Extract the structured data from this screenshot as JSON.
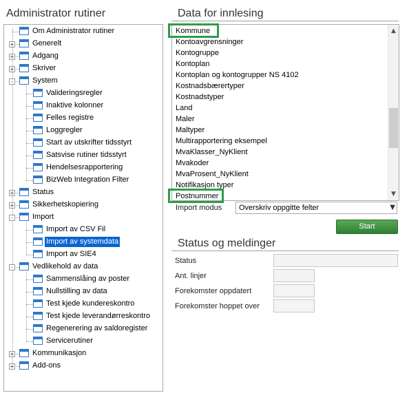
{
  "left_panel": {
    "title": "Administrator rutiner"
  },
  "tree": [
    {
      "label": "Om Administrator rutiner",
      "level": 0,
      "expander": "",
      "selected": false
    },
    {
      "label": "Generelt",
      "level": 0,
      "expander": "+",
      "selected": false
    },
    {
      "label": "Adgang",
      "level": 0,
      "expander": "+",
      "selected": false
    },
    {
      "label": "Skriver",
      "level": 0,
      "expander": "+",
      "selected": false
    },
    {
      "label": "System",
      "level": 0,
      "expander": "-",
      "selected": false
    },
    {
      "label": "Valideringsregler",
      "level": 1,
      "expander": "",
      "selected": false
    },
    {
      "label": "Inaktive kolonner",
      "level": 1,
      "expander": "",
      "selected": false
    },
    {
      "label": "Felles registre",
      "level": 1,
      "expander": "",
      "selected": false
    },
    {
      "label": "Loggregler",
      "level": 1,
      "expander": "",
      "selected": false
    },
    {
      "label": "Start av utskrifter tidsstyrt",
      "level": 1,
      "expander": "",
      "selected": false
    },
    {
      "label": "Satsvise rutiner tidsstyrt",
      "level": 1,
      "expander": "",
      "selected": false
    },
    {
      "label": "Hendelsesrapportering",
      "level": 1,
      "expander": "",
      "selected": false
    },
    {
      "label": "BizWeb Integration Filter",
      "level": 1,
      "expander": "",
      "selected": false
    },
    {
      "label": "Status",
      "level": 0,
      "expander": "+",
      "selected": false
    },
    {
      "label": "Sikkerhetskopiering",
      "level": 0,
      "expander": "+",
      "selected": false
    },
    {
      "label": "Import",
      "level": 0,
      "expander": "-",
      "selected": false
    },
    {
      "label": "Import av CSV Fil",
      "level": 1,
      "expander": "",
      "selected": false
    },
    {
      "label": "Import av systemdata",
      "level": 1,
      "expander": "",
      "selected": true
    },
    {
      "label": "Import av SIE4",
      "level": 1,
      "expander": "",
      "selected": false
    },
    {
      "label": "Vedlikehold av data",
      "level": 0,
      "expander": "-",
      "selected": false
    },
    {
      "label": "Sammenslåing av poster",
      "level": 1,
      "expander": "",
      "selected": false
    },
    {
      "label": "Nullstilling av data",
      "level": 1,
      "expander": "",
      "selected": false
    },
    {
      "label": "Test kjede kundereskontro",
      "level": 1,
      "expander": "",
      "selected": false
    },
    {
      "label": "Test kjede leverandørreskontro",
      "level": 1,
      "expander": "",
      "selected": false
    },
    {
      "label": "Regenerering av saldoregister",
      "level": 1,
      "expander": "",
      "selected": false
    },
    {
      "label": "Servicerutiner",
      "level": 1,
      "expander": "",
      "selected": false
    },
    {
      "label": "Kommunikasjon",
      "level": 0,
      "expander": "+",
      "selected": false
    },
    {
      "label": "Add-ons",
      "level": 0,
      "expander": "+",
      "selected": false
    }
  ],
  "data_panel": {
    "title": "Data for innlesing",
    "items": [
      "Kommune",
      "Kontoavgrensninger",
      "Kontogruppe",
      "Kontoplan",
      "Kontoplan og kontogrupper NS 4102",
      "Kostnadsbærertyper",
      "Kostnadstyper",
      "Land",
      "Maler",
      "Maltyper",
      "Multirapportering eksempel",
      "MvaKlasser_NyKlient",
      "Mvakoder",
      "MvaProsent_NyKlient",
      "Notifikasjon typer",
      "Postnummer"
    ],
    "highlighted": [
      "Kommune",
      "Postnummer"
    ],
    "import_mode_label": "Import modus",
    "import_mode_value": "Overskriv oppgitte felter",
    "start_label": "Start",
    "scroll_up_icon": "▲",
    "scroll_down_icon": "▼",
    "select_arrow_icon": "▼"
  },
  "status_panel": {
    "title": "Status og meldinger",
    "status_label": "Status",
    "lines_label": "Ant. linjer",
    "updated_label": "Forekomster oppdatert",
    "skipped_label": "Forekomster hoppet over",
    "status_value": "",
    "lines_value": "",
    "updated_value": "",
    "skipped_value": ""
  },
  "colors": {
    "highlight_border": "#2e9b4c",
    "selection": "#0a64d3",
    "start_button": "#3a8c3e",
    "tree_icon": "#2f77c9"
  }
}
